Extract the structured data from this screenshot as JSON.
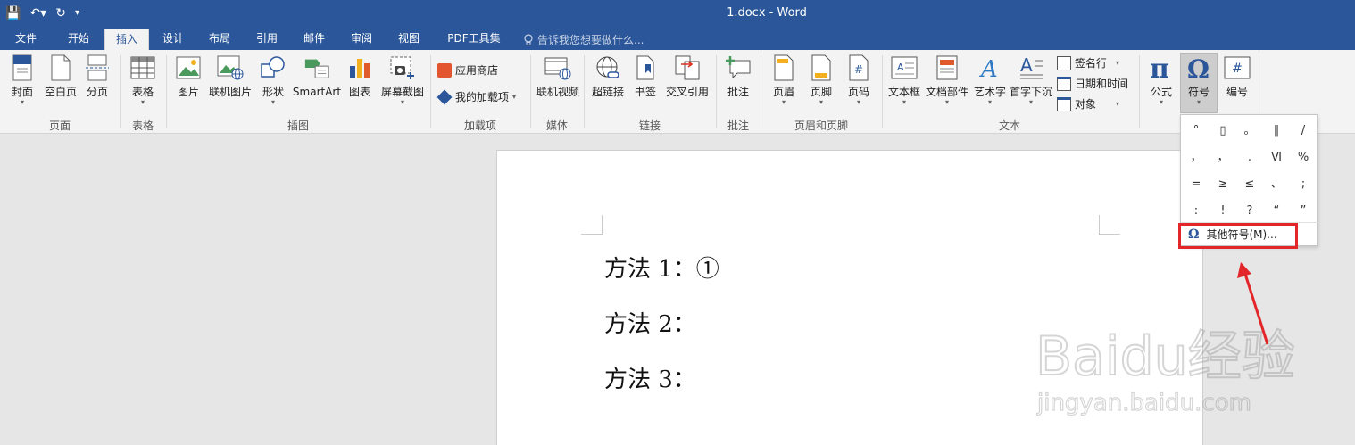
{
  "titlebar": {
    "title": "1.docx - Word",
    "qat": [
      "💾",
      "↶▾",
      "↻",
      "▾"
    ]
  },
  "tabs": {
    "items": [
      "文件",
      "开始",
      "插入",
      "设计",
      "布局",
      "引用",
      "邮件",
      "审阅",
      "视图",
      "PDF工具集"
    ],
    "active": "插入",
    "tell_me": "告诉我您想要做什么..."
  },
  "ribbon": {
    "pages": {
      "cover": "封面",
      "blank": "空白页",
      "break": "分页",
      "label": "页面"
    },
    "tables": {
      "table": "表格",
      "label": "表格"
    },
    "illustrations": {
      "picture": "图片",
      "online_picture": "联机图片",
      "shapes": "形状",
      "smartart": "SmartArt",
      "chart": "图表",
      "screenshot": "屏幕截图",
      "label": "插图"
    },
    "addins": {
      "store": "应用商店",
      "my_addins": "我的加载项",
      "label": "加载项"
    },
    "media": {
      "online_video": "联机视频",
      "label": "媒体"
    },
    "links": {
      "hyperlink": "超链接",
      "bookmark": "书签",
      "cross_ref": "交叉引用",
      "label": "链接"
    },
    "comments": {
      "comment": "批注",
      "label": "批注"
    },
    "header_footer": {
      "header": "页眉",
      "footer": "页脚",
      "page_number": "页码",
      "label": "页眉和页脚"
    },
    "text": {
      "textbox": "文本框",
      "quick_parts": "文档部件",
      "wordart": "艺术字",
      "dropcap": "首字下沉",
      "signature": "签名行",
      "datetime": "日期和时间",
      "object": "对象",
      "label": "文本"
    },
    "symbols": {
      "equation": "公式",
      "symbol": "符号",
      "numbering": "编号"
    }
  },
  "document": {
    "lines": [
      "方法 1：①",
      "方法 2：",
      "方法 3："
    ]
  },
  "symbol_panel": {
    "symbols": [
      "°",
      "▯",
      "。",
      "‖",
      "/",
      "，",
      "，",
      ".",
      "Ⅵ",
      "%",
      "=",
      "≥",
      "≤",
      "、",
      ";",
      ":",
      "!",
      "?",
      "“",
      "”"
    ],
    "more": "其他符号(M)...",
    "more_icon": "Ω"
  },
  "watermark": {
    "brand": "Baidu经验",
    "url": "jingyan.baidu.com"
  },
  "colors": {
    "accent": "#2b579a",
    "highlight": "#e2262a"
  }
}
